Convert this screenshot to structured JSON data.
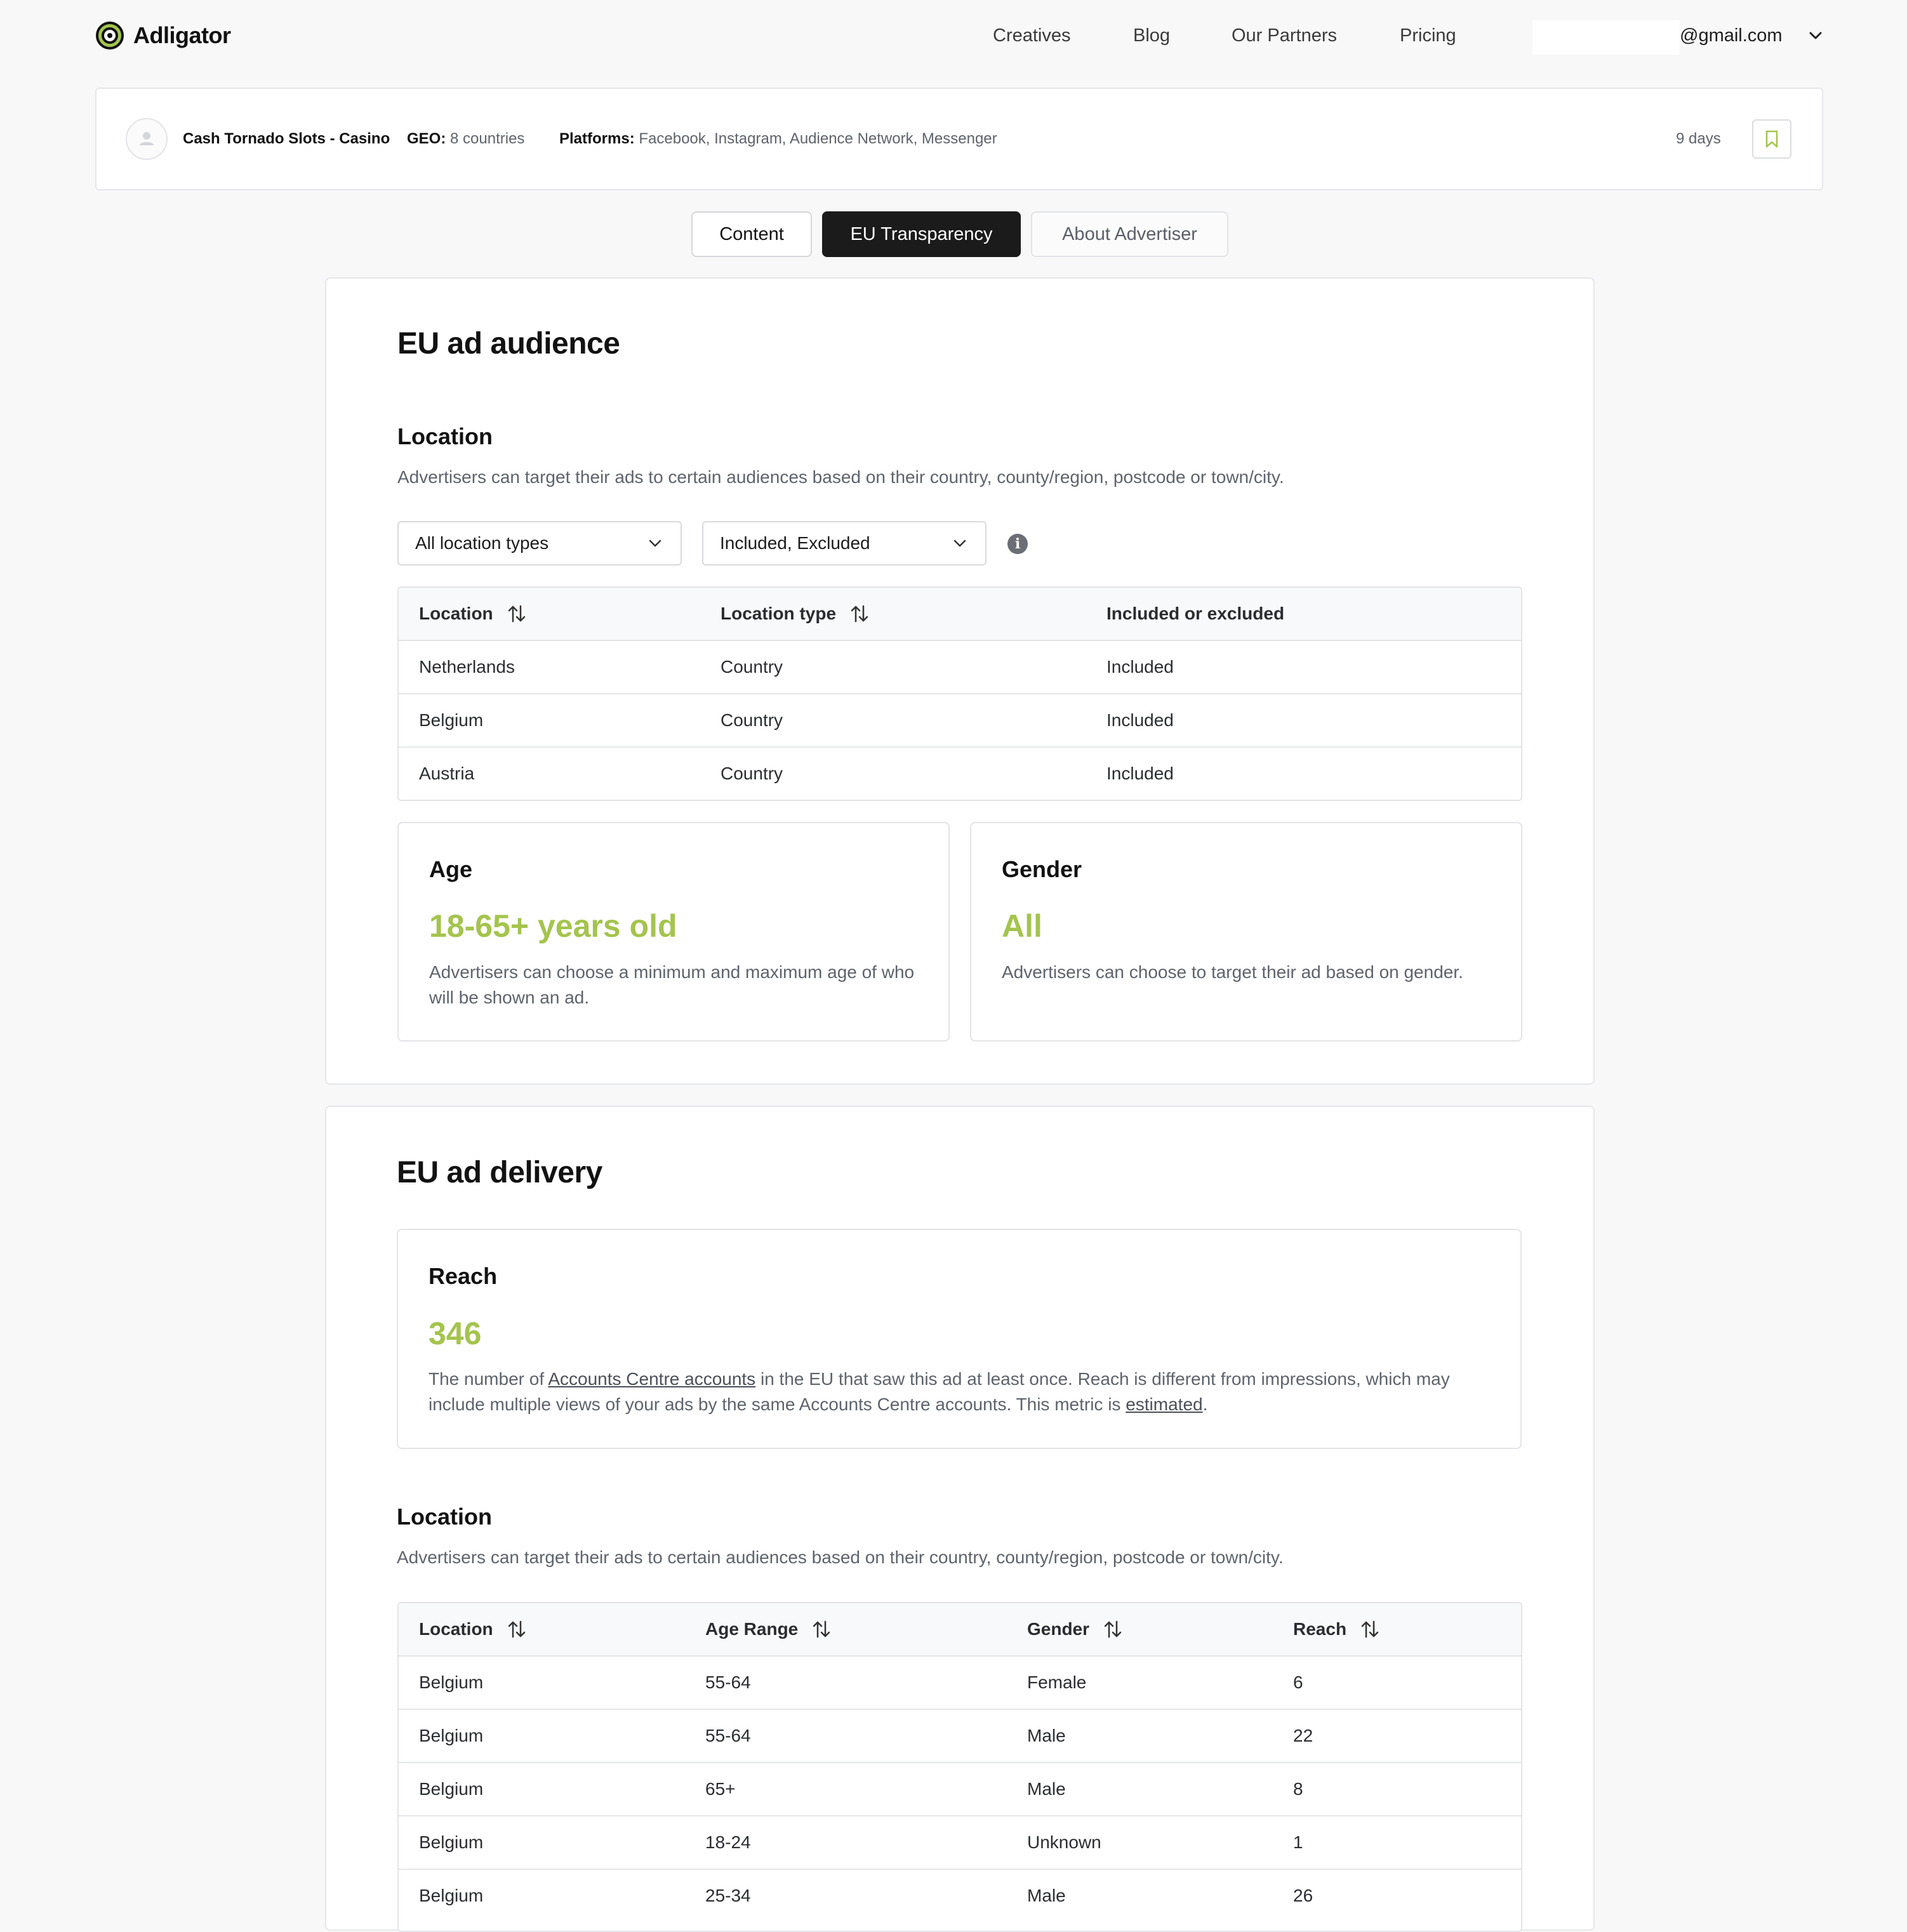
{
  "brand": {
    "name": "Adligator",
    "accent": "#a4c44e"
  },
  "nav": {
    "items": [
      "Creatives",
      "Blog",
      "Our Partners",
      "Pricing"
    ],
    "email": "@gmail.com"
  },
  "ad": {
    "title": "Cash Tornado Slots - Casino",
    "geo_label": "GEO:",
    "geo_value": "8 countries",
    "platforms_label": "Platforms:",
    "platforms_value": "Facebook, Instagram, Audience Network, Messenger",
    "duration": "9 days"
  },
  "tabs": {
    "content": "Content",
    "eu": "EU Transparency",
    "about": "About Advertiser"
  },
  "audience": {
    "title": "EU ad audience",
    "location_title": "Location",
    "location_desc": "Advertisers can target their ads to certain audiences based on their country, county/region, postcode or town/city.",
    "filter_type": "All location types",
    "filter_incl": "Included, Excluded",
    "table": {
      "headers": [
        "Location",
        "Location type",
        "Included or excluded"
      ],
      "rows": [
        [
          "Netherlands",
          "Country",
          "Included"
        ],
        [
          "Belgium",
          "Country",
          "Included"
        ],
        [
          "Austria",
          "Country",
          "Included"
        ]
      ]
    },
    "age": {
      "title": "Age",
      "value": "18-65+ years old",
      "desc": "Advertisers can choose a minimum and maximum age of who will be shown an ad."
    },
    "gender": {
      "title": "Gender",
      "value": "All",
      "desc": "Advertisers can choose to target their ad based on gender."
    }
  },
  "delivery": {
    "title": "EU ad delivery",
    "reach": {
      "title": "Reach",
      "value": "346",
      "desc_1": "The number of ",
      "link_1": "Accounts Centre accounts",
      "desc_2": " in the EU that saw this ad at least once. Reach is different from impressions, which may include multiple views of your ads by the same Accounts Centre accounts. This metric is ",
      "link_2": "estimated",
      "desc_3": "."
    },
    "location_title": "Location",
    "location_desc": "Advertisers can target their ads to certain audiences based on their country, county/region, postcode or town/city.",
    "table": {
      "headers": [
        "Location",
        "Age Range",
        "Gender",
        "Reach"
      ],
      "rows": [
        [
          "Belgium",
          "55-64",
          "Female",
          "6"
        ],
        [
          "Belgium",
          "55-64",
          "Male",
          "22"
        ],
        [
          "Belgium",
          "65+",
          "Male",
          "8"
        ],
        [
          "Belgium",
          "18-24",
          "Unknown",
          "1"
        ],
        [
          "Belgium",
          "25-34",
          "Male",
          "26"
        ]
      ]
    }
  }
}
